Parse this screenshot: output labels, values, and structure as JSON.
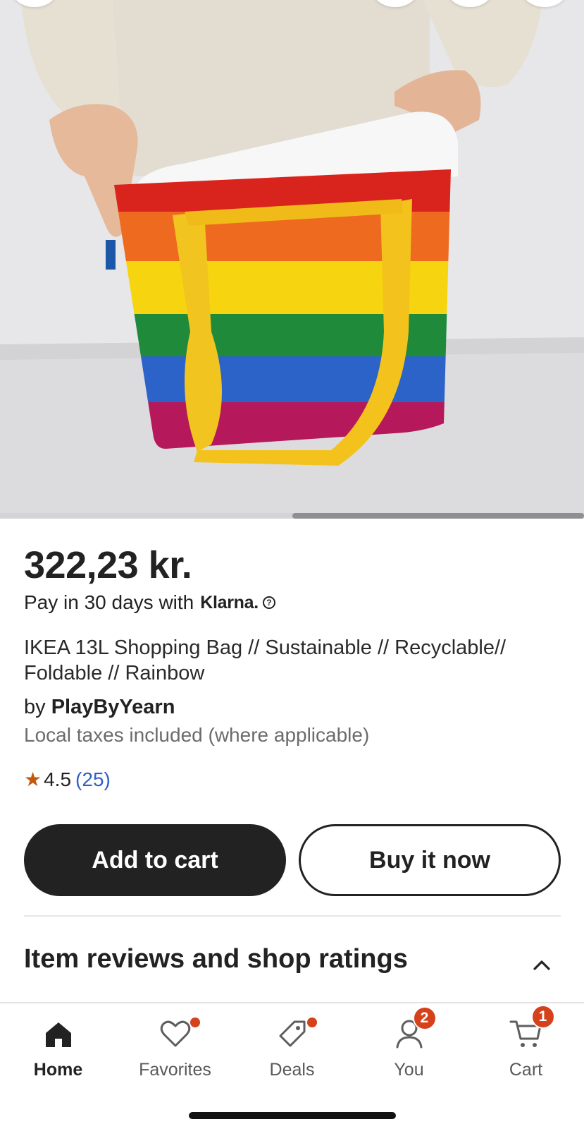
{
  "product": {
    "price": "322,23 kr.",
    "klarna_text": "Pay in 30 days with",
    "klarna_brand": "Klarna.",
    "title": "IKEA 13L Shopping Bag // Sustainable // Recyclable// Foldable // Rainbow",
    "seller_prefix": "by",
    "seller_name": "PlayByYearn",
    "tax_note": "Local taxes included (where applicable)",
    "rating_value": "4.5",
    "rating_count": "(25)",
    "image_index_fraction": 0.5
  },
  "actions": {
    "add_to_cart": "Add to cart",
    "buy_now": "Buy it now"
  },
  "sections": {
    "reviews_title": "Item reviews and shop ratings"
  },
  "nav": {
    "home": "Home",
    "favorites": "Favorites",
    "deals": "Deals",
    "you": "You",
    "you_badge": "2",
    "cart": "Cart",
    "cart_badge": "1"
  },
  "colors": {
    "primary_button": "#222222",
    "badge": "#d5411a",
    "rating_star": "#c4590c",
    "link": "#2f5fc4"
  },
  "icons": [
    "home-icon",
    "heart-icon",
    "tag-icon",
    "person-icon",
    "cart-icon",
    "star-icon",
    "help-icon",
    "chevron-up-icon"
  ]
}
